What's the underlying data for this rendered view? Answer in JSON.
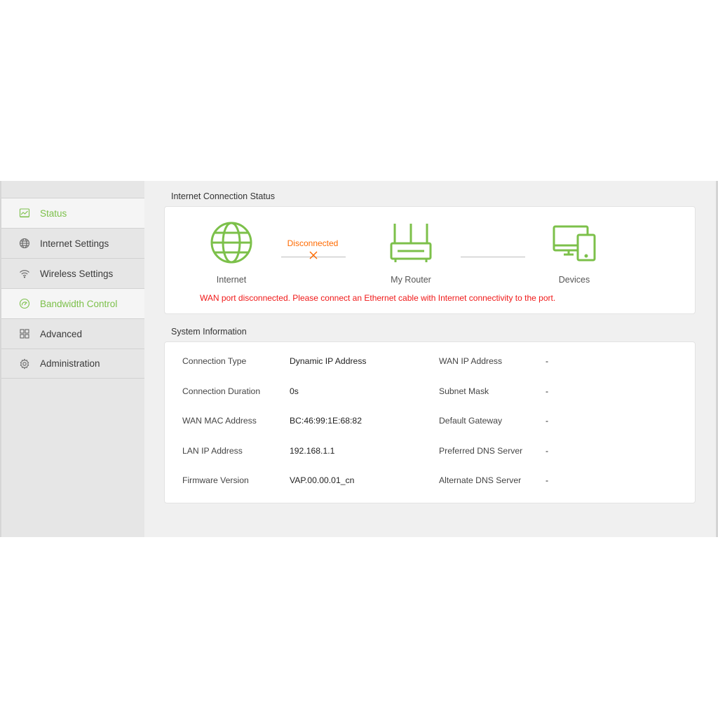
{
  "colors": {
    "accent_green": "#7cc04a",
    "error_red": "#f01818",
    "disconnected_orange": "#ff6a00"
  },
  "sidebar": {
    "items": [
      {
        "label": "Status",
        "icon": "status-chart-icon",
        "state": "active"
      },
      {
        "label": "Internet Settings",
        "icon": "globe-icon"
      },
      {
        "label": "Wireless Settings",
        "icon": "wifi-icon"
      },
      {
        "label": "Bandwidth Control",
        "icon": "gauge-icon",
        "state": "highlighted"
      },
      {
        "label": "Advanced",
        "icon": "grid-icon"
      },
      {
        "label": "Administration",
        "icon": "gear-icon"
      }
    ]
  },
  "status": {
    "title": "Internet Connection Status",
    "internet_label": "Internet",
    "router_label": "My Router",
    "devices_label": "Devices",
    "link_status": "Disconnected",
    "link_status_icon": "cross-icon",
    "warning": "WAN port disconnected. Please connect an Ethernet cable with Internet connectivity to the port."
  },
  "system": {
    "title": "System Information",
    "rows": [
      {
        "label": "Connection Type",
        "value": "Dynamic IP Address",
        "label2": "WAN IP Address",
        "value2": "-"
      },
      {
        "label": "Connection Duration",
        "value": "0s",
        "label2": "Subnet Mask",
        "value2": "-"
      },
      {
        "label": "WAN MAC Address",
        "value": "BC:46:99:1E:68:82",
        "label2": "Default Gateway",
        "value2": "-"
      },
      {
        "label": "LAN IP Address",
        "value": "192.168.1.1",
        "label2": "Preferred DNS Server",
        "value2": "-"
      },
      {
        "label": "Firmware Version",
        "value": "VAP.00.00.01_cn",
        "label2": "Alternate DNS Server",
        "value2": "-"
      }
    ]
  }
}
